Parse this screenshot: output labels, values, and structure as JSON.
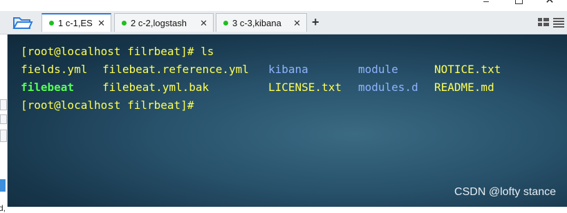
{
  "window": {
    "controls": {
      "minimize": "–",
      "close": "✕"
    }
  },
  "tabs": [
    {
      "label": "1 c-1,ES",
      "active": true,
      "close": "✕"
    },
    {
      "label": "2 c-2,logstash",
      "active": false,
      "close": "✕"
    },
    {
      "label": "3 c-3,kibana",
      "active": false,
      "close": "✕"
    }
  ],
  "tabbar": {
    "add_tab": "+"
  },
  "colors": {
    "accent": "#2a7bd8",
    "status_dot": "#1fbf1f",
    "terminal_yellow": "#ffff55",
    "terminal_blue": "#8fb4ff",
    "terminal_green": "#55ff55"
  },
  "left_strip": {
    "text": "d,"
  },
  "terminal": {
    "prompt1": "[root@localhost filrbeat]# ls",
    "row1": [
      "fields.yml",
      "filebeat.reference.yml",
      "kibana",
      "module",
      "NOTICE.txt"
    ],
    "row2": [
      "filebeat",
      "filebeat.yml.bak",
      "LICENSE.txt",
      "modules.d",
      "README.md"
    ],
    "prompt2": "[root@localhost filrbeat]#"
  },
  "watermark": "CSDN @lofty stance"
}
